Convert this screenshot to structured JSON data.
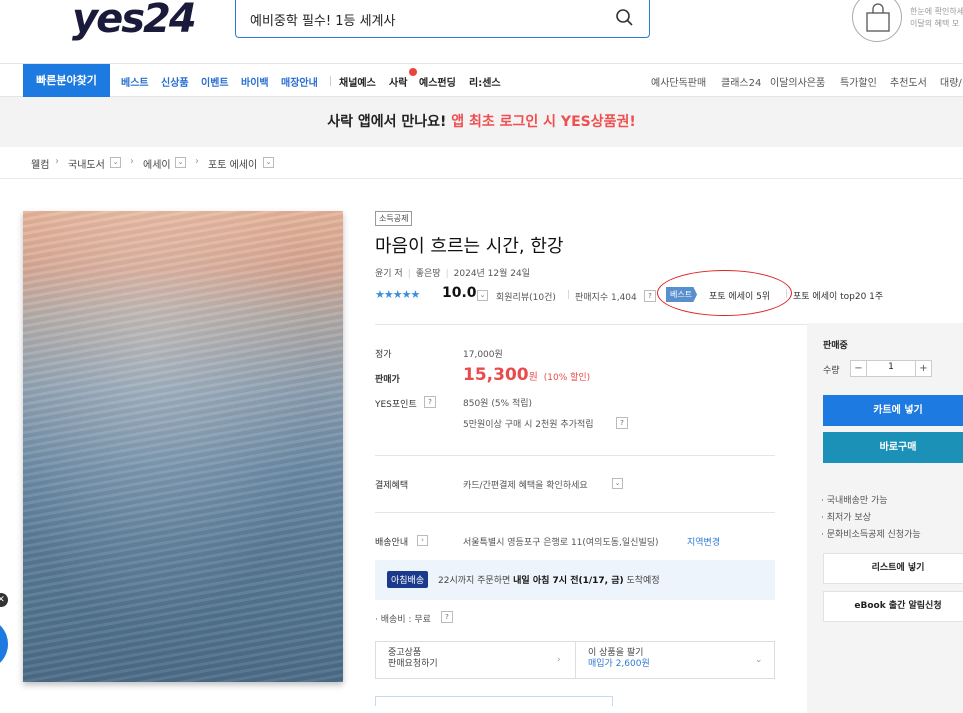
{
  "header": {
    "logo": "yes24",
    "search_value": "예비중학 필수! 1등 세계사",
    "cart_promo_line1": "한눈에 확인하세",
    "cart_promo_line2": "이달의 혜택 모"
  },
  "gnb": {
    "quick_find": "빠른분야찾기",
    "items": [
      "베스트",
      "신상품",
      "이벤트",
      "바이백",
      "매장안내"
    ],
    "items_dark": [
      "채널예스",
      "사락",
      "예스펀딩",
      "리:센스"
    ],
    "right_items": [
      "예사단독판매",
      "클래스24",
      "이달의사은품",
      "특가할인",
      "추천도서",
      "대량/"
    ]
  },
  "banner": {
    "text_main": "사락 앱에서 만나요! ",
    "text_highlight": "앱 최초 로그인 시 YES상품권!"
  },
  "breadcrumb": {
    "home": "웰컴",
    "level1": "국내도서",
    "level2": "에세이",
    "level3": "포토 에세이"
  },
  "product": {
    "tax_badge": "소득공제",
    "title": "마음이 흐르는 시간, 한강",
    "author": "윤기 저",
    "publisher": "좋은땅",
    "pub_date": "2024년 12월 24일",
    "rating": "10.0",
    "reviews": "회원리뷰(10건)",
    "sales_index": "판매지수 1,404",
    "best_label": "베스트",
    "best_rank": "포토 에세이 5위",
    "top20": "포토 에세이 top20 1주",
    "list_price_label": "정가",
    "list_price": "17,000원",
    "sale_price_label": "판매가",
    "sale_price": "15,300",
    "sale_price_unit": "원",
    "discount": "(10% 할인)",
    "points_label": "YES포인트",
    "points": "850원 (5% 적립)",
    "points_extra": "5만원이상 구매 시 2천원 추가적립",
    "benefit_label": "결제혜택",
    "benefit": "카드/간편결제 혜택을 확인하세요",
    "shipping_label": "배송안내",
    "shipping_addr": "서울특별시 영등포구 은행로 11(여의도동,일신빌딩)",
    "region_change": "지역변경",
    "morning_tag": "아침배송",
    "morning_text_pre": "22시까지 주문하면 ",
    "morning_text_bold": "내일 아침 7시 전(1/17, 금)",
    "morning_text_post": " 도착예정",
    "shipping_fee": "배송비 : 무료",
    "used_line1": "중고상품",
    "used_line2": "판매요청하기",
    "sell_line1": "이 상품을 팔기",
    "sell_line2": "매입가 2,600원"
  },
  "buybox": {
    "status": "판매중",
    "qty_label": "수량",
    "qty": "1",
    "cart_btn": "카트에 넣기",
    "buy_btn": "바로구매",
    "notes": [
      "국내배송만 가능",
      "최저가 보상",
      "문화비소득공제 신청가능"
    ],
    "list_btn": "리스트에 넣기",
    "ebook_btn": "eBook 출간 알림신청"
  },
  "colors": {
    "accent": "#1d7ae0",
    "price": "#e94a4a",
    "best": "#5a8fcd",
    "buy": "#1c91b8"
  }
}
